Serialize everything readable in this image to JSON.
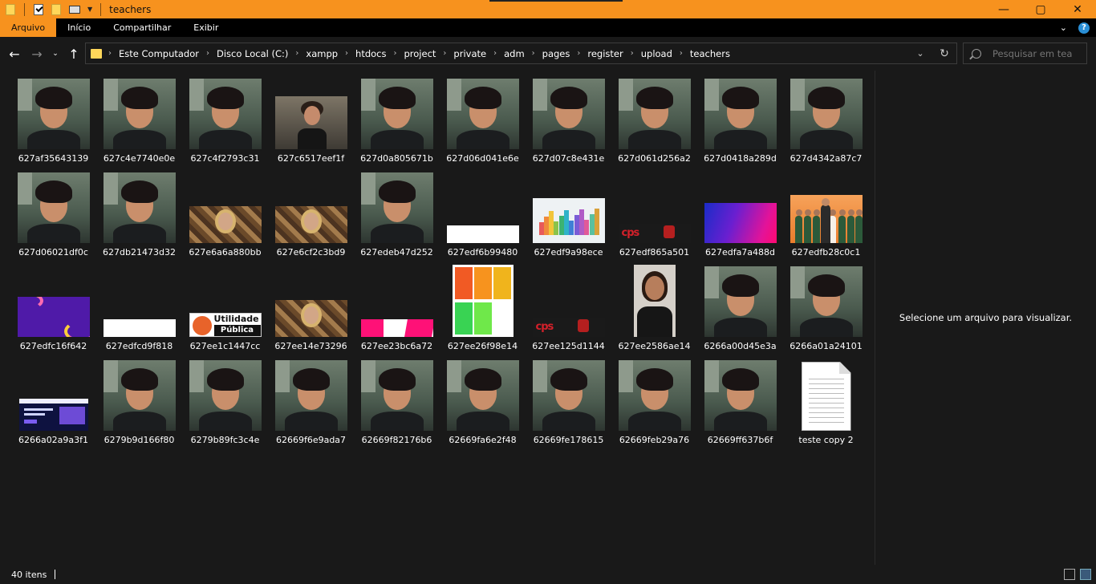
{
  "window": {
    "title": "teachers",
    "controls": {
      "minimize": "—",
      "maximize": "▢",
      "close": "✕"
    }
  },
  "ribbon": {
    "tabs": [
      "Arquivo",
      "Início",
      "Compartilhar",
      "Exibir"
    ],
    "active_tab": "Arquivo"
  },
  "address": {
    "breadcrumbs": [
      "Este Computador",
      "Disco Local (C:)",
      "xampp",
      "htdocs",
      "project",
      "private",
      "adm",
      "pages",
      "register",
      "upload",
      "teachers"
    ]
  },
  "search": {
    "placeholder": "Pesquisar em teac..."
  },
  "preview": {
    "message": "Selecione um arquivo para visualizar."
  },
  "files": [
    {
      "name": "627af35643139",
      "thumb": "selfie"
    },
    {
      "name": "627c4e7740e0e",
      "thumb": "selfie"
    },
    {
      "name": "627c4f2793c31",
      "thumb": "selfie"
    },
    {
      "name": "627c6517eef1f",
      "thumb": "woman-landscape"
    },
    {
      "name": "627d0a805671b",
      "thumb": "selfie"
    },
    {
      "name": "627d06d041e6e",
      "thumb": "selfie"
    },
    {
      "name": "627d07c8e431e",
      "thumb": "selfie"
    },
    {
      "name": "627d061d256a2",
      "thumb": "selfie"
    },
    {
      "name": "627d0418a289d",
      "thumb": "selfie"
    },
    {
      "name": "627d4342a87c7",
      "thumb": "selfie"
    },
    {
      "name": "627d06021df0c",
      "thumb": "selfie"
    },
    {
      "name": "627db21473d32",
      "thumb": "selfie"
    },
    {
      "name": "627e6a6a880bb",
      "thumb": "gold-portrait"
    },
    {
      "name": "627e6cf2c3bd9",
      "thumb": "gold-portrait"
    },
    {
      "name": "627edeb47d252",
      "thumb": "selfie"
    },
    {
      "name": "627edf6b99480",
      "thumb": "white-bar"
    },
    {
      "name": "627edf9a98ece",
      "thumb": "color-chart"
    },
    {
      "name": "627edf865a501",
      "thumb": "cps-logo"
    },
    {
      "name": "627edfa7a488d",
      "thumb": "gradient-magenta"
    },
    {
      "name": "627edfb28c0c1",
      "thumb": "kids-orange"
    },
    {
      "name": "627edfc16f642",
      "thumb": "purple-waves"
    },
    {
      "name": "627edfcd9f818",
      "thumb": "white-bar"
    },
    {
      "name": "627ee1c1447cc",
      "thumb": "utilidade-publica"
    },
    {
      "name": "627ee14e73296",
      "thumb": "gold-portrait"
    },
    {
      "name": "627ee23bc6a72",
      "thumb": "pink-stripes"
    },
    {
      "name": "627ee26f98e14",
      "thumb": "palette"
    },
    {
      "name": "627ee125d1144",
      "thumb": "cps-logo"
    },
    {
      "name": "627ee2586ae14",
      "thumb": "portrait-girl"
    },
    {
      "name": "6266a00d45e3a",
      "thumb": "selfie"
    },
    {
      "name": "6266a01a24101",
      "thumb": "selfie"
    },
    {
      "name": "6266a02a9a3f1",
      "thumb": "website"
    },
    {
      "name": "6279b9d166f80",
      "thumb": "selfie"
    },
    {
      "name": "6279b89fc3c4e",
      "thumb": "selfie"
    },
    {
      "name": "62669f6e9ada7",
      "thumb": "selfie"
    },
    {
      "name": "62669f82176b6",
      "thumb": "selfie"
    },
    {
      "name": "62669fa6e2f48",
      "thumb": "selfie"
    },
    {
      "name": "62669fe178615",
      "thumb": "selfie"
    },
    {
      "name": "62669feb29a76",
      "thumb": "selfie"
    },
    {
      "name": "62669ff637b6f",
      "thumb": "selfie"
    },
    {
      "name": "teste copy 2",
      "thumb": "text-file"
    }
  ],
  "thumb_text": {
    "cps": "cps",
    "utilidade_line1": "Utilidade",
    "utilidade_line2": "Pública"
  },
  "status": {
    "item_count": "40 itens"
  },
  "colors": {
    "titlebar": "#f7921e",
    "background": "#191919",
    "ribbon": "#000000"
  }
}
